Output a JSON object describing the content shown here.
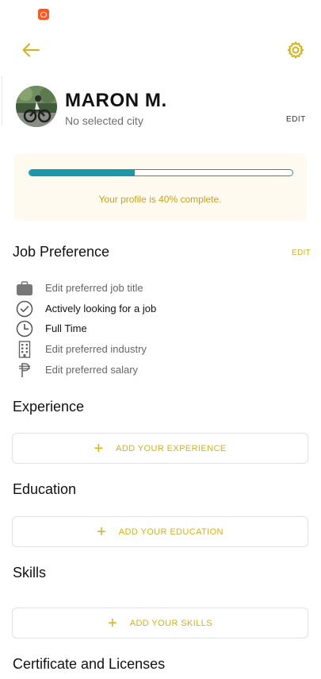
{
  "status_bar": {
    "app_icon": "app-notification-icon"
  },
  "header": {
    "back_icon": "arrow-left-icon",
    "settings_icon": "gear-icon"
  },
  "profile": {
    "name": "MARON M.",
    "city": "No selected city",
    "edit_label": "EDIT",
    "avatar": "avatar-photo"
  },
  "completion": {
    "percent": 40,
    "text": "Your profile is 40% complete."
  },
  "job_preference": {
    "title": "Job Preference",
    "edit_label": "EDIT",
    "items": [
      {
        "icon": "briefcase-icon",
        "label": "Edit preferred job title"
      },
      {
        "icon": "check-circle-icon",
        "label": "Actively looking for a job"
      },
      {
        "icon": "clock-icon",
        "label": "Full Time"
      },
      {
        "icon": "building-icon",
        "label": "Edit preferred industry"
      },
      {
        "icon": "peso-icon",
        "label": "Edit preferred salary"
      }
    ]
  },
  "experience": {
    "title": "Experience",
    "add_label": "ADD YOUR EXPERIENCE"
  },
  "education": {
    "title": "Education",
    "add_label": "ADD YOUR EDUCATION"
  },
  "skills": {
    "title": "Skills",
    "add_label": "ADD YOUR SKILLS"
  },
  "certificates": {
    "title": "Certificate and Licenses"
  },
  "colors": {
    "accent": "#d8b117",
    "progress": "#1b97a8",
    "card_bg": "#fffaf0",
    "status_app": "#ff5722"
  }
}
